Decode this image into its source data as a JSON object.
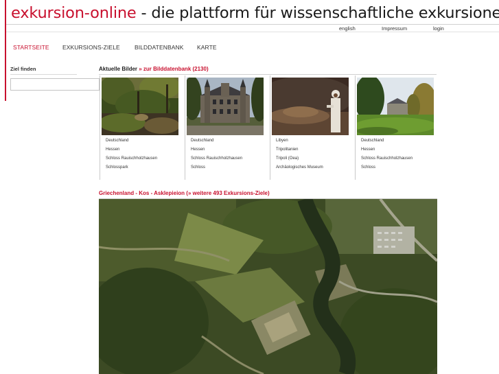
{
  "header": {
    "brand": "exkursion-online",
    "tagline": " - die plattform für wissenschaftliche exkursionen"
  },
  "toplinks": [
    "english",
    "Impressum",
    "login"
  ],
  "nav": {
    "items": [
      "STARTSEITE",
      "EXKURSIONS-ZIELE",
      "BILDDATENBANK",
      "KARTE"
    ],
    "active": "STARTSEITE"
  },
  "sidebar": {
    "label": "Ziel finden",
    "search_value": ""
  },
  "images": {
    "heading_prefix": "Aktuelle Bilder",
    "heading_link": "» zur Bilddatenbank (2130)",
    "cards": [
      {
        "photo": "garden-park-photo",
        "lines": [
          "Deutschland",
          "Hessen",
          "Schloss Rauischholzhausen",
          "Schlosspark"
        ]
      },
      {
        "photo": "castle-photo",
        "lines": [
          "Deutschland",
          "Hessen",
          "Schloss Rauischholzhausen",
          "Schloss"
        ]
      },
      {
        "photo": "museum-figure-photo",
        "lines": [
          "Libyen",
          "Tripolitanien",
          "Tripoli (Oea)",
          "Archäologisches Museum"
        ]
      },
      {
        "photo": "manor-meadow-photo",
        "lines": [
          "Deutschland",
          "Hessen",
          "Schloss Rauischholzhausen",
          "Schloss"
        ]
      }
    ]
  },
  "destination": {
    "heading": "Griechenland - Kos - Asklepieion (» weitere 493 Exkursions-Ziele)",
    "image": "aerial-photo-asklepieion"
  },
  "colors": {
    "accent": "#c8102e",
    "text": "#222222",
    "rule": "#d0d0d0"
  }
}
